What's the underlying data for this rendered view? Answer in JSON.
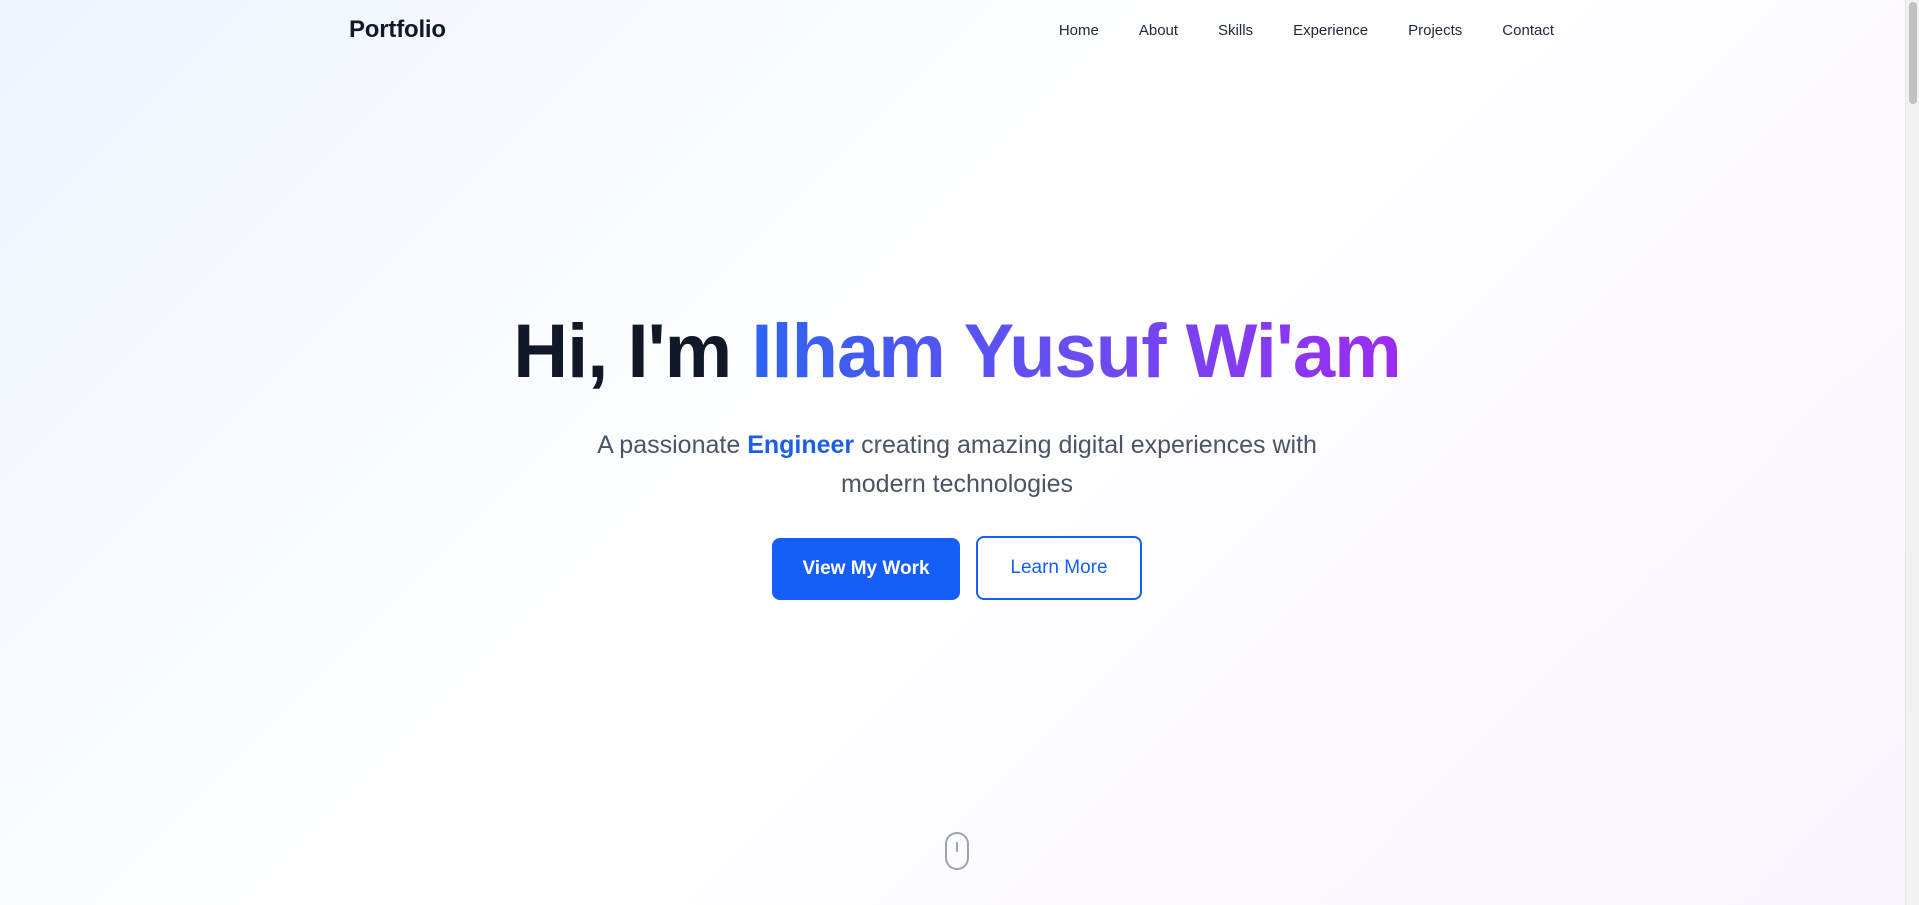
{
  "navbar": {
    "brand": "Portfolio",
    "links": [
      {
        "label": "Home"
      },
      {
        "label": "About"
      },
      {
        "label": "Skills"
      },
      {
        "label": "Experience"
      },
      {
        "label": "Projects"
      },
      {
        "label": "Contact"
      }
    ]
  },
  "hero": {
    "greeting": "Hi, I'm ",
    "name": "Ilham Yusuf Wi'am",
    "subtitle_prefix": "A passionate ",
    "subtitle_highlight": "Engineer",
    "subtitle_suffix": " creating amazing digital experiences with modern technologies",
    "primary_button": "View My Work",
    "secondary_button": "Learn More"
  },
  "icons": {
    "scroll_indicator": "mouse-scroll-icon"
  },
  "colors": {
    "accent": "#155ef7",
    "highlight": "#1d5fe4",
    "gradient_start": "#2d63f0",
    "gradient_mid": "#6a4cf2",
    "gradient_end": "#9b2cf0",
    "title_text": "#111827",
    "body_text": "#4b5563"
  }
}
